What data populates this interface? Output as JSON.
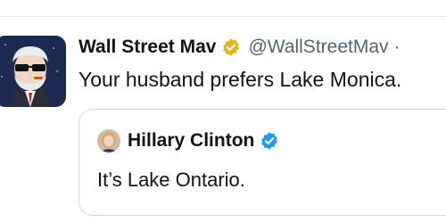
{
  "tweet": {
    "author_name": "Wall Street Mav",
    "author_handle": "@WallStreetMav",
    "separator": "·",
    "text": "Your husband prefers Lake Monica.",
    "verified_badge_color": "#e2b719",
    "avatar_icon": "cartoon-man-sunglasses-avatar"
  },
  "quote": {
    "author_name": "Hillary Clinton",
    "text": "It’s Lake Ontario.",
    "verified_badge_color": "#1d9bf0",
    "avatar_icon": "profile-photo-avatar"
  },
  "colors": {
    "text_primary": "#0f1419",
    "text_secondary": "#536471",
    "border": "#cfd9de"
  }
}
